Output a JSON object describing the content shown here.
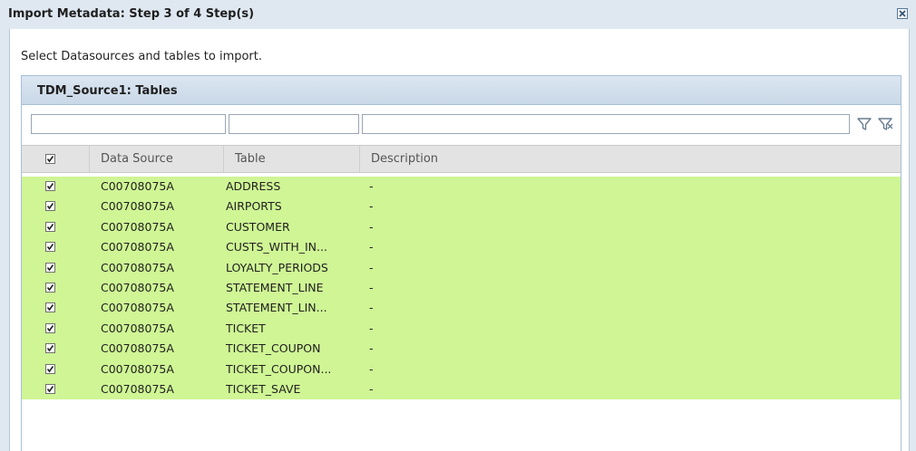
{
  "dialog": {
    "title": "Import Metadata: Step 3 of 4 Step(s)",
    "instruction": "Select Datasources and tables to import."
  },
  "panel": {
    "title": "TDM_Source1: Tables"
  },
  "filters": {
    "data_source": "",
    "table": "",
    "description": ""
  },
  "columns": {
    "data_source": "Data Source",
    "table": "Table",
    "description": "Description"
  },
  "header_checkbox_checked": true,
  "rows": [
    {
      "checked": true,
      "data_source": "C00708075A",
      "table": "ADDRESS",
      "description": "-"
    },
    {
      "checked": true,
      "data_source": "C00708075A",
      "table": "AIRPORTS",
      "description": "-"
    },
    {
      "checked": true,
      "data_source": "C00708075A",
      "table": "CUSTOMER",
      "description": "-"
    },
    {
      "checked": true,
      "data_source": "C00708075A",
      "table": "CUSTS_WITH_IN...",
      "description": "-"
    },
    {
      "checked": true,
      "data_source": "C00708075A",
      "table": "LOYALTY_PERIODS",
      "description": "-"
    },
    {
      "checked": true,
      "data_source": "C00708075A",
      "table": "STATEMENT_LINE",
      "description": "-"
    },
    {
      "checked": true,
      "data_source": "C00708075A",
      "table": "STATEMENT_LIN...",
      "description": "-"
    },
    {
      "checked": true,
      "data_source": "C00708075A",
      "table": "TICKET",
      "description": "-"
    },
    {
      "checked": true,
      "data_source": "C00708075A",
      "table": "TICKET_COUPON",
      "description": "-"
    },
    {
      "checked": true,
      "data_source": "C00708075A",
      "table": "TICKET_COUPON...",
      "description": "-"
    },
    {
      "checked": true,
      "data_source": "C00708075A",
      "table": "TICKET_SAVE",
      "description": "-"
    }
  ],
  "icons": {
    "close": "close-icon",
    "filter": "filter-icon",
    "clear_filter": "clear-filter-icon"
  },
  "colors": {
    "selected_row": "#cff595",
    "title_bar": "#dfe8f1"
  }
}
